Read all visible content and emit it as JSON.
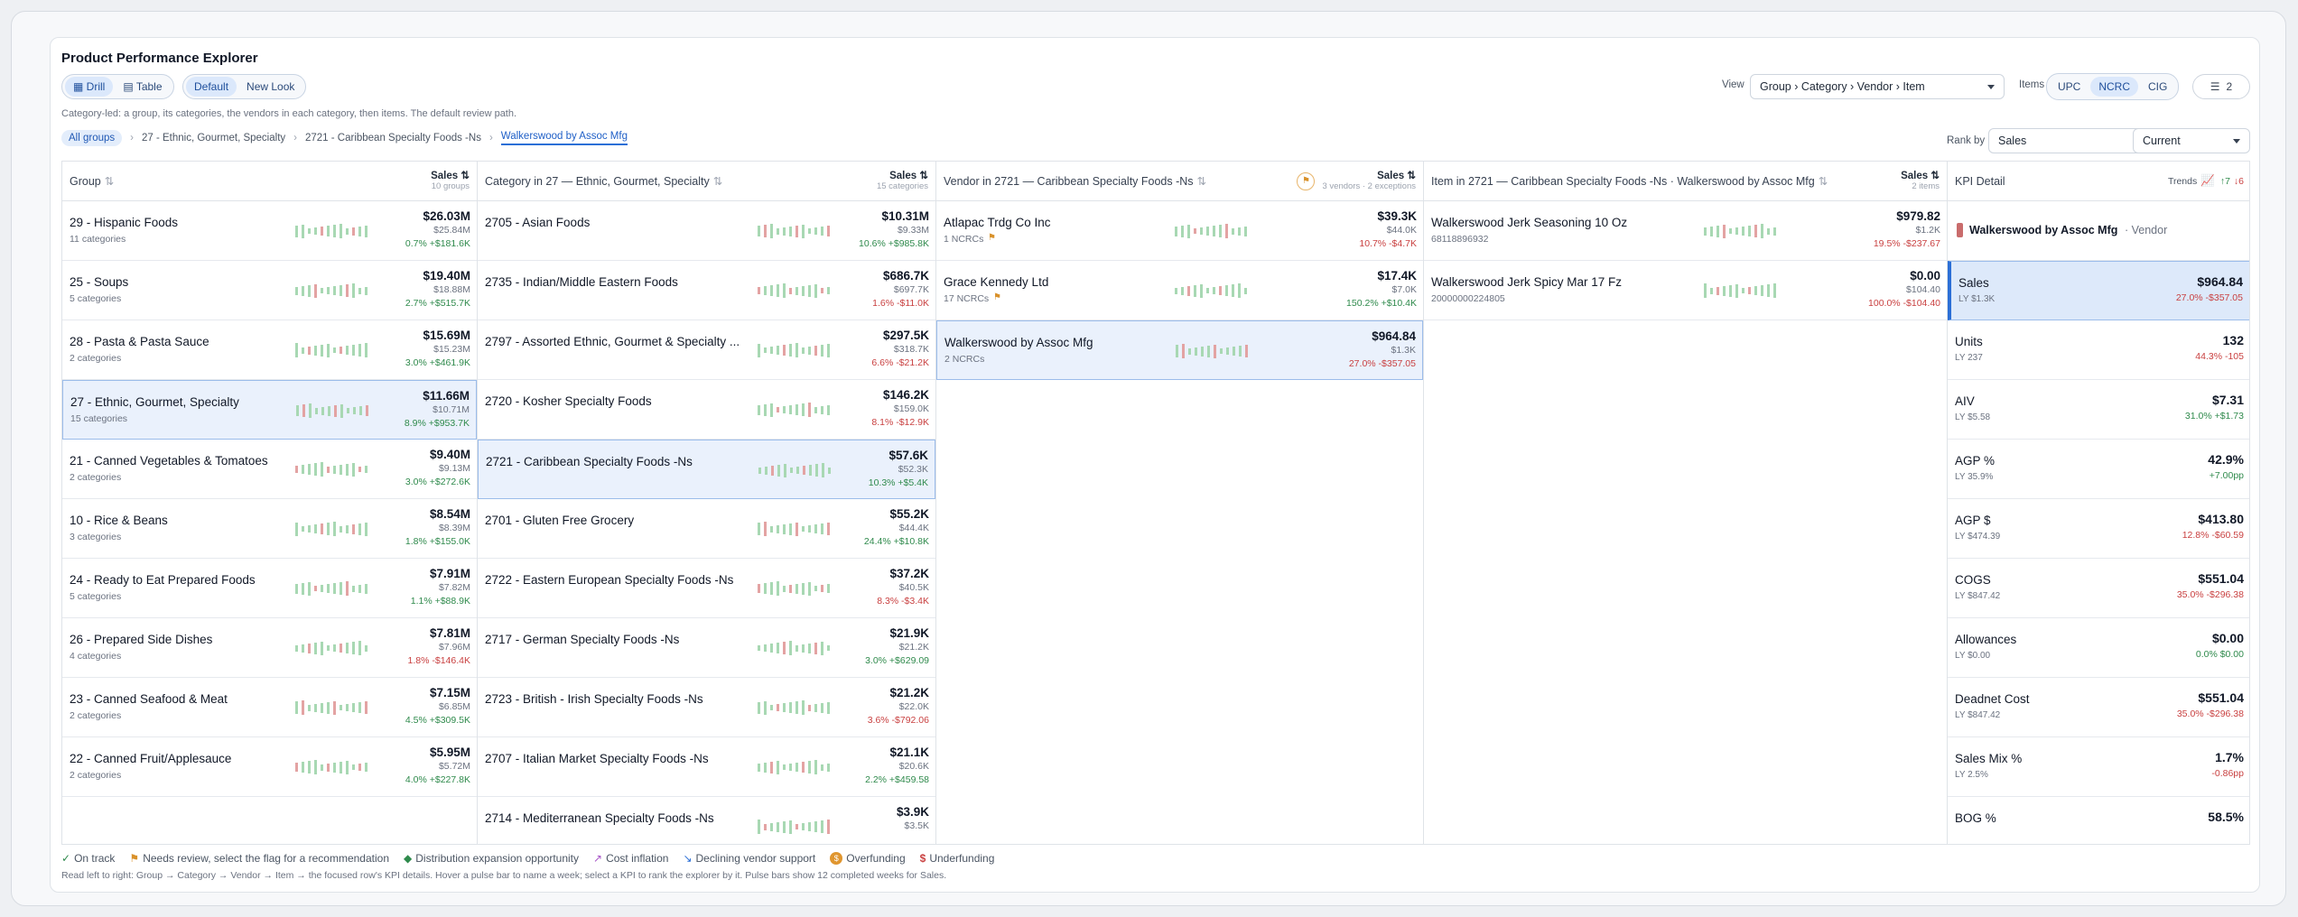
{
  "title": "Product Performance Explorer",
  "modes": {
    "drill": "Drill",
    "table": "Table"
  },
  "looks": {
    "default": "Default",
    "new": "New Look"
  },
  "description": "Category-led: a group, its categories, the vendors in each category, then items. The default review path.",
  "breadcrumb": {
    "all": "All groups",
    "c1": "27 - Ethnic, Gourmet, Specialty",
    "c2": "2721 - Caribbean Specialty Foods -Ns",
    "c3": "Walkerswood by Assoc Mfg"
  },
  "view": {
    "label": "View",
    "value": "Group › Category › Vendor › Item"
  },
  "items": {
    "label": "Items",
    "upc": "UPC",
    "ncrc": "NCRC",
    "cig": "CIG"
  },
  "filter": {
    "count": "2"
  },
  "rank": {
    "label": "Rank by",
    "value": "Sales",
    "period": "Current"
  },
  "colors": {
    "accent": "#2b6fd6",
    "positive": "#2f8a4c",
    "negative": "#c94141",
    "spark": "#9dd1a8"
  },
  "group": {
    "header": "Group",
    "sort": "Sales",
    "count": "10 groups",
    "rows": [
      {
        "name": "29 - Hispanic Foods",
        "sub": "11 categories",
        "v": "$26.03M",
        "ly": "$25.84M",
        "chg": "0.7% +$181.6K",
        "dir": "pos"
      },
      {
        "name": "25 - Soups",
        "sub": "5 categories",
        "v": "$19.40M",
        "ly": "$18.88M",
        "chg": "2.7% +$515.7K",
        "dir": "pos"
      },
      {
        "name": "28 - Pasta & Pasta Sauce",
        "sub": "2 categories",
        "v": "$15.69M",
        "ly": "$15.23M",
        "chg": "3.0% +$461.9K",
        "dir": "pos"
      },
      {
        "name": "27 - Ethnic, Gourmet, Specialty",
        "sub": "15 categories",
        "v": "$11.66M",
        "ly": "$10.71M",
        "chg": "8.9% +$953.7K",
        "dir": "pos"
      },
      {
        "name": "21 - Canned Vegetables & Tomatoes",
        "sub": "2 categories",
        "v": "$9.40M",
        "ly": "$9.13M",
        "chg": "3.0% +$272.6K",
        "dir": "pos"
      },
      {
        "name": "10 - Rice & Beans",
        "sub": "3 categories",
        "v": "$8.54M",
        "ly": "$8.39M",
        "chg": "1.8% +$155.0K",
        "dir": "pos"
      },
      {
        "name": "24 - Ready to Eat Prepared Foods",
        "sub": "5 categories",
        "v": "$7.91M",
        "ly": "$7.82M",
        "chg": "1.1% +$88.9K",
        "dir": "pos"
      },
      {
        "name": "26 - Prepared Side Dishes",
        "sub": "4 categories",
        "v": "$7.81M",
        "ly": "$7.96M",
        "chg": "1.8% -$146.4K",
        "dir": "neg"
      },
      {
        "name": "23 - Canned Seafood & Meat",
        "sub": "2 categories",
        "v": "$7.15M",
        "ly": "$6.85M",
        "chg": "4.5% +$309.5K",
        "dir": "pos"
      },
      {
        "name": "22 - Canned Fruit/Applesauce",
        "sub": "2 categories",
        "v": "$5.95M",
        "ly": "$5.72M",
        "chg": "4.0% +$227.8K",
        "dir": "pos"
      }
    ]
  },
  "category": {
    "header": "Category in 27 — Ethnic, Gourmet, Specialty",
    "sort": "Sales",
    "count": "15 categories",
    "rows": [
      {
        "name": "2705 - Asian Foods",
        "v": "$10.31M",
        "ly": "$9.33M",
        "chg": "10.6% +$985.8K",
        "dir": "pos"
      },
      {
        "name": "2735 - Indian/Middle Eastern Foods",
        "v": "$686.7K",
        "ly": "$697.7K",
        "chg": "1.6% -$11.0K",
        "dir": "neg"
      },
      {
        "name": "2797 - Assorted Ethnic, Gourmet & Specialty ...",
        "v": "$297.5K",
        "ly": "$318.7K",
        "chg": "6.6% -$21.2K",
        "dir": "neg"
      },
      {
        "name": "2720 - Kosher Specialty Foods",
        "v": "$146.2K",
        "ly": "$159.0K",
        "chg": "8.1% -$12.9K",
        "dir": "neg"
      },
      {
        "name": "2721 - Caribbean Specialty Foods -Ns",
        "v": "$57.6K",
        "ly": "$52.3K",
        "chg": "10.3% +$5.4K",
        "dir": "pos"
      },
      {
        "name": "2701 - Gluten Free Grocery",
        "v": "$55.2K",
        "ly": "$44.4K",
        "chg": "24.4% +$10.8K",
        "dir": "pos"
      },
      {
        "name": "2722 - Eastern European Specialty Foods -Ns",
        "v": "$37.2K",
        "ly": "$40.5K",
        "chg": "8.3% -$3.4K",
        "dir": "neg"
      },
      {
        "name": "2717 - German Specialty Foods -Ns",
        "v": "$21.9K",
        "ly": "$21.2K",
        "chg": "3.0% +$629.09",
        "dir": "pos"
      },
      {
        "name": "2723 - British - Irish Specialty Foods -Ns",
        "v": "$21.2K",
        "ly": "$22.0K",
        "chg": "3.6% -$792.06",
        "dir": "neg"
      },
      {
        "name": "2707 - Italian Market Specialty Foods -Ns",
        "v": "$21.1K",
        "ly": "$20.6K",
        "chg": "2.2% +$459.58",
        "dir": "pos"
      },
      {
        "name": "2714 - Mediterranean Specialty Foods -Ns",
        "v": "$3.9K",
        "ly": "$3.5K",
        "chg": "",
        "dir": "pos"
      }
    ]
  },
  "vendor": {
    "header": "Vendor in 2721 — Caribbean Specialty Foods -Ns",
    "sort": "Sales",
    "count": "3 vendors · 2 exceptions",
    "rows": [
      {
        "name": "Atlapac Trdg Co Inc",
        "sub": "1 NCRCs",
        "v": "$39.3K",
        "ly": "$44.0K",
        "chg": "10.7% -$4.7K",
        "dir": "neg",
        "flag": true
      },
      {
        "name": "Grace Kennedy Ltd",
        "sub": "17 NCRCs",
        "v": "$17.4K",
        "ly": "$7.0K",
        "chg": "150.2% +$10.4K",
        "dir": "pos",
        "flag": true
      },
      {
        "name": "Walkerswood by Assoc Mfg",
        "sub": "2 NCRCs",
        "v": "$964.84",
        "ly": "$1.3K",
        "chg": "27.0% -$357.05",
        "dir": "neg",
        "flag": false
      }
    ]
  },
  "item": {
    "header": "Item in 2721 — Caribbean Specialty Foods -Ns · Walkerswood by Assoc Mfg",
    "sort": "Sales",
    "count": "2 items",
    "rows": [
      {
        "name": "Walkerswood Jerk Seasoning 10 Oz",
        "sub": "68118896932",
        "v": "$979.82",
        "ly": "$1.2K",
        "chg": "19.5% -$237.67",
        "dir": "neg"
      },
      {
        "name": "Walkerswood Jerk Spicy Mar 17 Fz",
        "sub": "20000000224805",
        "v": "$0.00",
        "ly": "$104.40",
        "chg": "100.0% -$104.40",
        "dir": "neg"
      }
    ]
  },
  "kpi": {
    "header": "KPI Detail",
    "trends": "Trends",
    "up": "7",
    "down": "6",
    "entity": "Walkerswood by Assoc Mfg",
    "entity_type": "· Vendor",
    "rows": [
      {
        "name": "Sales",
        "ly": "LY $1.3K",
        "v": "$964.84",
        "chg": "27.0% -$357.05",
        "dir": "neg"
      },
      {
        "name": "Units",
        "ly": "LY 237",
        "v": "132",
        "chg": "44.3% -105",
        "dir": "neg"
      },
      {
        "name": "AIV",
        "ly": "LY $5.58",
        "v": "$7.31",
        "chg": "31.0% +$1.73",
        "dir": "pos"
      },
      {
        "name": "AGP %",
        "ly": "LY 35.9%",
        "v": "42.9%",
        "chg": "+7.00pp",
        "dir": "pos"
      },
      {
        "name": "AGP $",
        "ly": "LY $474.39",
        "v": "$413.80",
        "chg": "12.8% -$60.59",
        "dir": "neg"
      },
      {
        "name": "COGS",
        "ly": "LY $847.42",
        "v": "$551.04",
        "chg": "35.0% -$296.38",
        "dir": "neg"
      },
      {
        "name": "Allowances",
        "ly": "LY $0.00",
        "v": "$0.00",
        "chg": "0.0% $0.00",
        "dir": "pos"
      },
      {
        "name": "Deadnet Cost",
        "ly": "LY $847.42",
        "v": "$551.04",
        "chg": "35.0% -$296.38",
        "dir": "neg"
      },
      {
        "name": "Sales Mix %",
        "ly": "LY 2.5%",
        "v": "1.7%",
        "chg": "-0.86pp",
        "dir": "neg"
      },
      {
        "name": "BOG %",
        "ly": "",
        "v": "58.5%",
        "chg": "",
        "dir": "pos"
      }
    ]
  },
  "legend": {
    "ontrack": "On track",
    "review": "Needs review, select the flag for a recommendation",
    "expansion": "Distribution expansion opportunity",
    "inflation": "Cost inflation",
    "declining": "Declining vendor support",
    "over": "Overfunding",
    "under": "Underfunding"
  },
  "footnote": "Read left to right: Group → Category → Vendor → Item → the focused row's KPI details. Hover a pulse bar to name a week; select a KPI to rank the explorer by it. Pulse bars show 12 completed weeks for Sales."
}
